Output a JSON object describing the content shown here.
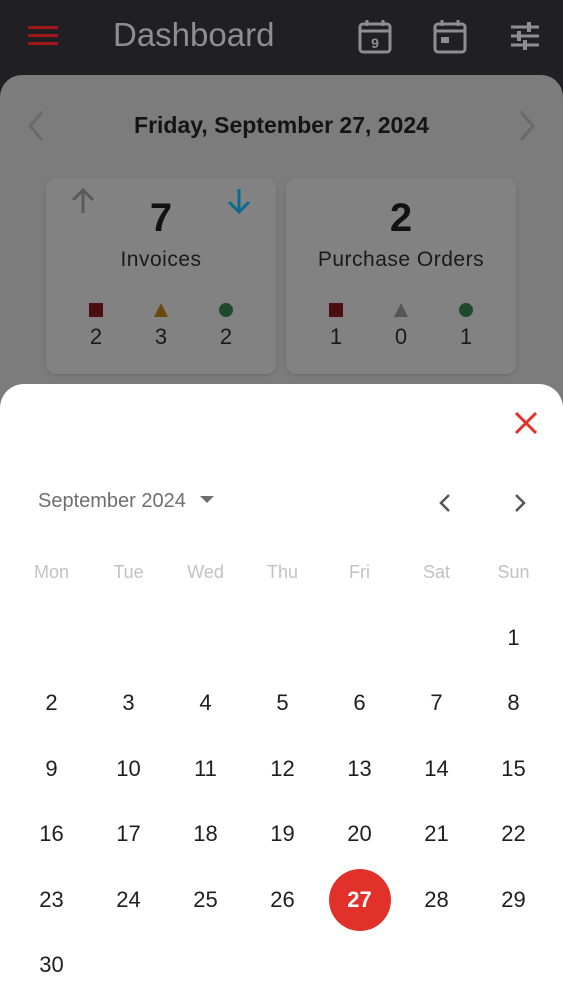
{
  "appbar": {
    "title": "Dashboard",
    "today_icon_number": "9",
    "colors": {
      "background": "#1f1f24",
      "menu": "#a11818",
      "title": "#8e8e92"
    }
  },
  "dashboard": {
    "date_text": "Friday, September 27, 2024",
    "cards": [
      {
        "count": "7",
        "label": "Invoices",
        "stats": [
          {
            "shape": "square",
            "value": "2"
          },
          {
            "shape": "triangle",
            "value": "3"
          },
          {
            "shape": "circle",
            "value": "2"
          }
        ]
      },
      {
        "count": "2",
        "label": "Purchase Orders",
        "stats": [
          {
            "shape": "square",
            "value": "1"
          },
          {
            "shape": "triangle",
            "value": "0"
          },
          {
            "shape": "circle",
            "value": "1"
          }
        ]
      }
    ]
  },
  "picker": {
    "month_label": "September 2024",
    "weekdays": [
      "Mon",
      "Tue",
      "Wed",
      "Thu",
      "Fri",
      "Sat",
      "Sun"
    ],
    "days": [
      "1",
      "2",
      "3",
      "4",
      "5",
      "6",
      "7",
      "8",
      "9",
      "10",
      "11",
      "12",
      "13",
      "14",
      "15",
      "16",
      "17",
      "18",
      "19",
      "20",
      "21",
      "22",
      "23",
      "24",
      "25",
      "26",
      "27",
      "28",
      "29",
      "30"
    ],
    "selected_day": "27",
    "colors": {
      "accent": "#e1312a"
    }
  }
}
